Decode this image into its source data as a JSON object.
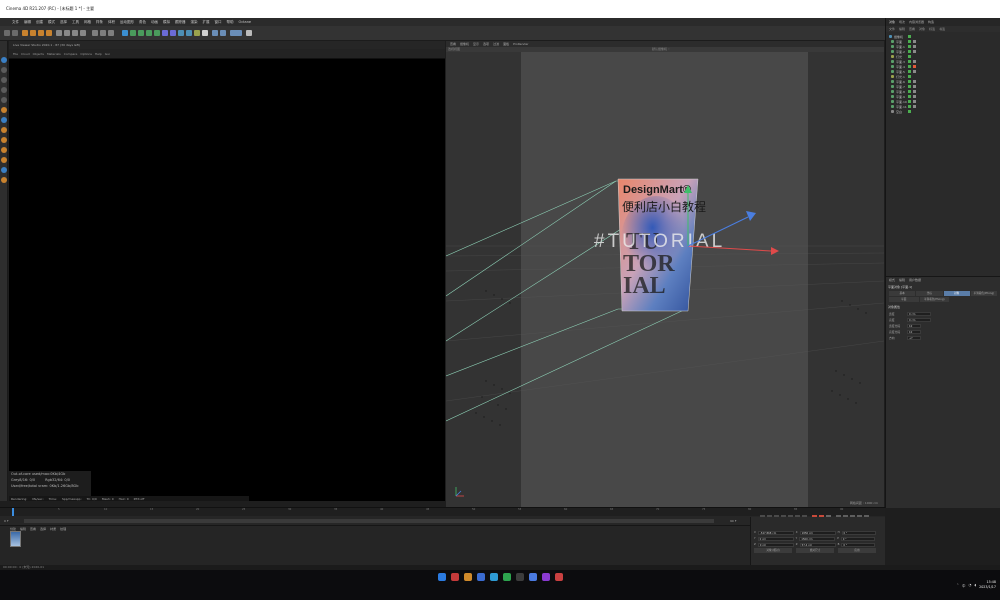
{
  "window": {
    "title": "Cinema 4D R21.207 (RC) - [未标题 1 *] - 主要"
  },
  "menu": {
    "items": [
      "文件",
      "编辑",
      "创建",
      "模式",
      "选择",
      "工具",
      "网格",
      "样条",
      "体积",
      "运动图形",
      "角色",
      "动画",
      "模拟",
      "跟踪器",
      "渲染",
      "扩展",
      "窗口",
      "帮助",
      "Octane"
    ]
  },
  "picture_viewer": {
    "title": "Live Viewer Studio 2020.1 - 87 (30 days left)",
    "menu": [
      "File",
      "Cloud",
      "Objects",
      "Materials",
      "Compare",
      "Options",
      "Help",
      "Gui"
    ],
    "info": {
      "out_of_core": "Out-of-core used/max:0Kb/4Gb",
      "grey_8_16": "Grey8/16: 0/0",
      "rgb_32_64": "Rgb32/64: 0/0",
      "used_free_total_vram": "Used/free/total vram: 0Kb/1.26Gb/8Gb"
    },
    "status": {
      "rendering": "Rendering:",
      "ms_sec": "Ms/sec:",
      "time": "Time:",
      "spp": "Spp/maxspp:",
      "tri": "Tri: 0/0",
      "mesh": "Mesh: 0",
      "hair": "Hair: 0",
      "rtx": "RTX:off"
    }
  },
  "viewport": {
    "menu": [
      "查看",
      "摄像机",
      "显示",
      "选项",
      "过滤",
      "面板",
      "ProRender"
    ],
    "view_label": "透视视图",
    "camera_label": "默认摄像机 ◦",
    "grid_distance": "网格间距 : 1000 cm",
    "poster": {
      "brand": "DesignMart®",
      "subtitle": "便利店小白教程",
      "hashtag": "#TUTORIAL",
      "line_1": "TU",
      "line_2": "TOR",
      "line_3": "IAL"
    }
  },
  "object_manager": {
    "tabs": [
      "对象",
      "场次",
      "内容浏览器",
      "构造"
    ],
    "menu": [
      "文件",
      "编辑",
      "查看",
      "对象",
      "标签",
      "书签"
    ],
    "objects": [
      "摄像机",
      "平面",
      "平面.1",
      "平面.2",
      "灯光",
      "平面.3",
      "平面.4",
      "平面.5",
      "灯光.1",
      "平面.6",
      "平面.7",
      "平面.8",
      "平面.9",
      "平面.10",
      "平面.11",
      "空白"
    ]
  },
  "attributes": {
    "tabs": [
      "模式",
      "编辑",
      "用户数据"
    ],
    "title": "平面对象 [平面.1]",
    "subtabs": [
      "基本",
      "坐标",
      "对象",
      "平滑着色(Phong)"
    ],
    "subtabs2": [
      "平面",
      "平滑着色(Phong)"
    ],
    "section": "对象属性",
    "fields": [
      {
        "label": "宽度",
        "value": "0 cm"
      },
      {
        "label": "高度",
        "value": "0 cm"
      },
      {
        "label": "宽度分段",
        "value": "10"
      },
      {
        "label": "高度分段",
        "value": "10"
      },
      {
        "label": "方向",
        "value": "+Y"
      }
    ]
  },
  "timeline": {
    "ticks": [
      "0",
      "5",
      "10",
      "15",
      "20",
      "25",
      "30",
      "35",
      "40",
      "45",
      "50",
      "55",
      "60",
      "65",
      "70",
      "75",
      "80",
      "85",
      "90"
    ],
    "current_frame": "0 F",
    "end_frame": "90 F"
  },
  "materials": {
    "tabs": [
      "创建",
      "编辑",
      "查看",
      "选择",
      "材质",
      "纹理"
    ]
  },
  "coordinates": {
    "rows": [
      {
        "axis": "X",
        "pos": "-547.868 cm",
        "size_label": "X",
        "size": "1850 cm",
        "rot_label": "H",
        "rot": "0 °"
      },
      {
        "axis": "Y",
        "pos": "0 cm",
        "size_label": "Y",
        "size": "1500 cm",
        "rot_label": "P",
        "rot": "0 °"
      },
      {
        "axis": "Z",
        "pos": "0 cm",
        "size_label": "Z",
        "size": "57.4 cm",
        "rot_label": "B",
        "rot": "0 °"
      }
    ],
    "mode_1": "对象 (相对)",
    "mode_2": "绝对尺寸",
    "apply": "应用"
  },
  "status_bar": {
    "text": "00:00:00 : 0 (未知) 2020-01"
  },
  "taskbar": {
    "time": "15:48",
    "date": "2023/1/17",
    "lang": "中"
  }
}
